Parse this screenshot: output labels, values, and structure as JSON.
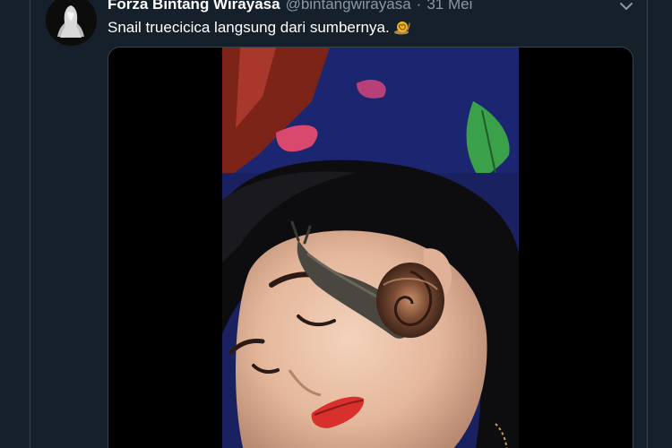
{
  "tweet": {
    "display_name": "Forza Bintang Wirayasa",
    "handle": "@bintangwirayasa",
    "separator": "·",
    "date": "31 Mei",
    "text": "Snail truecicica langsung dari sumbernya.",
    "emoji": "snail-emoji"
  },
  "icons": {
    "more": "chevron-down-icon",
    "avatar": "ghost-avatar"
  },
  "colors": {
    "background": "#15202b",
    "border": "#38444d",
    "secondary_text": "#8899a6",
    "primary_text": "#ffffff"
  }
}
